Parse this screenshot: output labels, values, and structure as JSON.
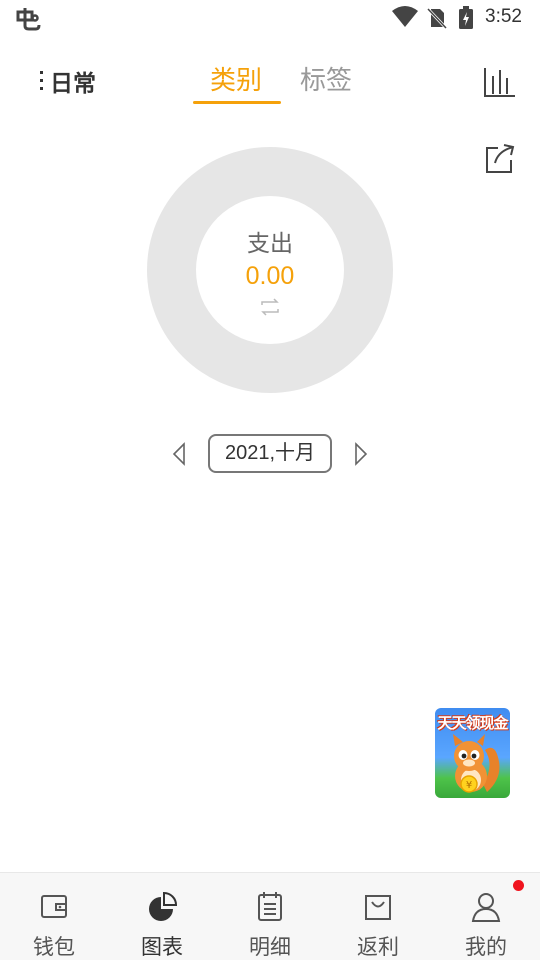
{
  "status_bar": {
    "time": "3:52",
    "icons": [
      "app-notification-icon",
      "wifi-icon",
      "no-sim-icon",
      "battery-charging-icon"
    ]
  },
  "header": {
    "book_label": "日常",
    "tabs": [
      {
        "label": "类别",
        "active": true
      },
      {
        "label": "标签",
        "active": false
      }
    ],
    "right_icons": [
      "bar-chart-icon",
      "share-icon"
    ]
  },
  "summary": {
    "title": "支出",
    "value": "0.00",
    "swap_icon": "swap-icon"
  },
  "month_selector": {
    "label": "2021,十月",
    "prev_icon": "chevron-left-icon",
    "next_icon": "chevron-right-icon"
  },
  "promo": {
    "text": "天天领现金"
  },
  "bottom_nav": {
    "items": [
      {
        "label": "钱包",
        "icon": "wallet-icon",
        "active": false
      },
      {
        "label": "图表",
        "icon": "pie-chart-icon",
        "active": true
      },
      {
        "label": "明细",
        "icon": "list-icon",
        "active": false
      },
      {
        "label": "返利",
        "icon": "shopping-bag-icon",
        "active": false
      },
      {
        "label": "我的",
        "icon": "user-icon",
        "active": false
      }
    ]
  },
  "colors": {
    "accent": "#f5a10a",
    "donut": "#e6e6e6",
    "badge_dot": "#f0141e",
    "nav_bg": "#f7f7f7"
  }
}
